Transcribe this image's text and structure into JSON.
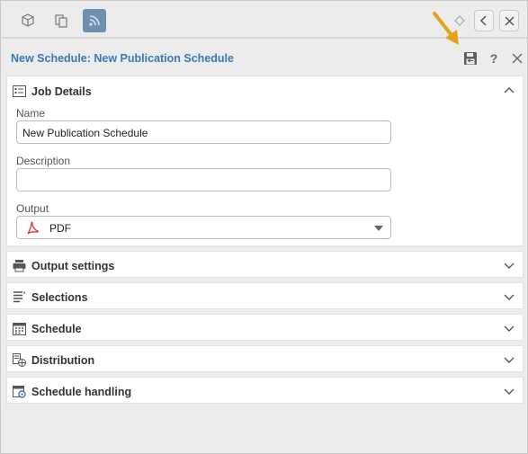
{
  "header": {
    "title": "New Schedule: New Publication Schedule",
    "help_label": "?"
  },
  "job_details": {
    "section_label": "Job Details",
    "name": {
      "label": "Name",
      "value": "New Publication Schedule"
    },
    "description": {
      "label": "Description",
      "value": ""
    },
    "output": {
      "label": "Output",
      "value": "PDF"
    }
  },
  "sections": [
    {
      "label": "Output settings",
      "icon": "printer-icon"
    },
    {
      "label": "Selections",
      "icon": "list-icon"
    },
    {
      "label": "Schedule",
      "icon": "calendar-icon"
    },
    {
      "label": "Distribution",
      "icon": "distribution-icon"
    },
    {
      "label": "Schedule handling",
      "icon": "calendar-gear-icon"
    }
  ],
  "colors": {
    "title": "#3a78b3",
    "active_tab": "#6f8fae",
    "annotation_arrow": "#e3a21a"
  },
  "icons": [
    "cube-icon",
    "copy-icon",
    "feed-icon",
    "diamond-icon",
    "chevron-left-icon",
    "close-icon",
    "save-icon",
    "help-icon",
    "pdf-icon"
  ]
}
